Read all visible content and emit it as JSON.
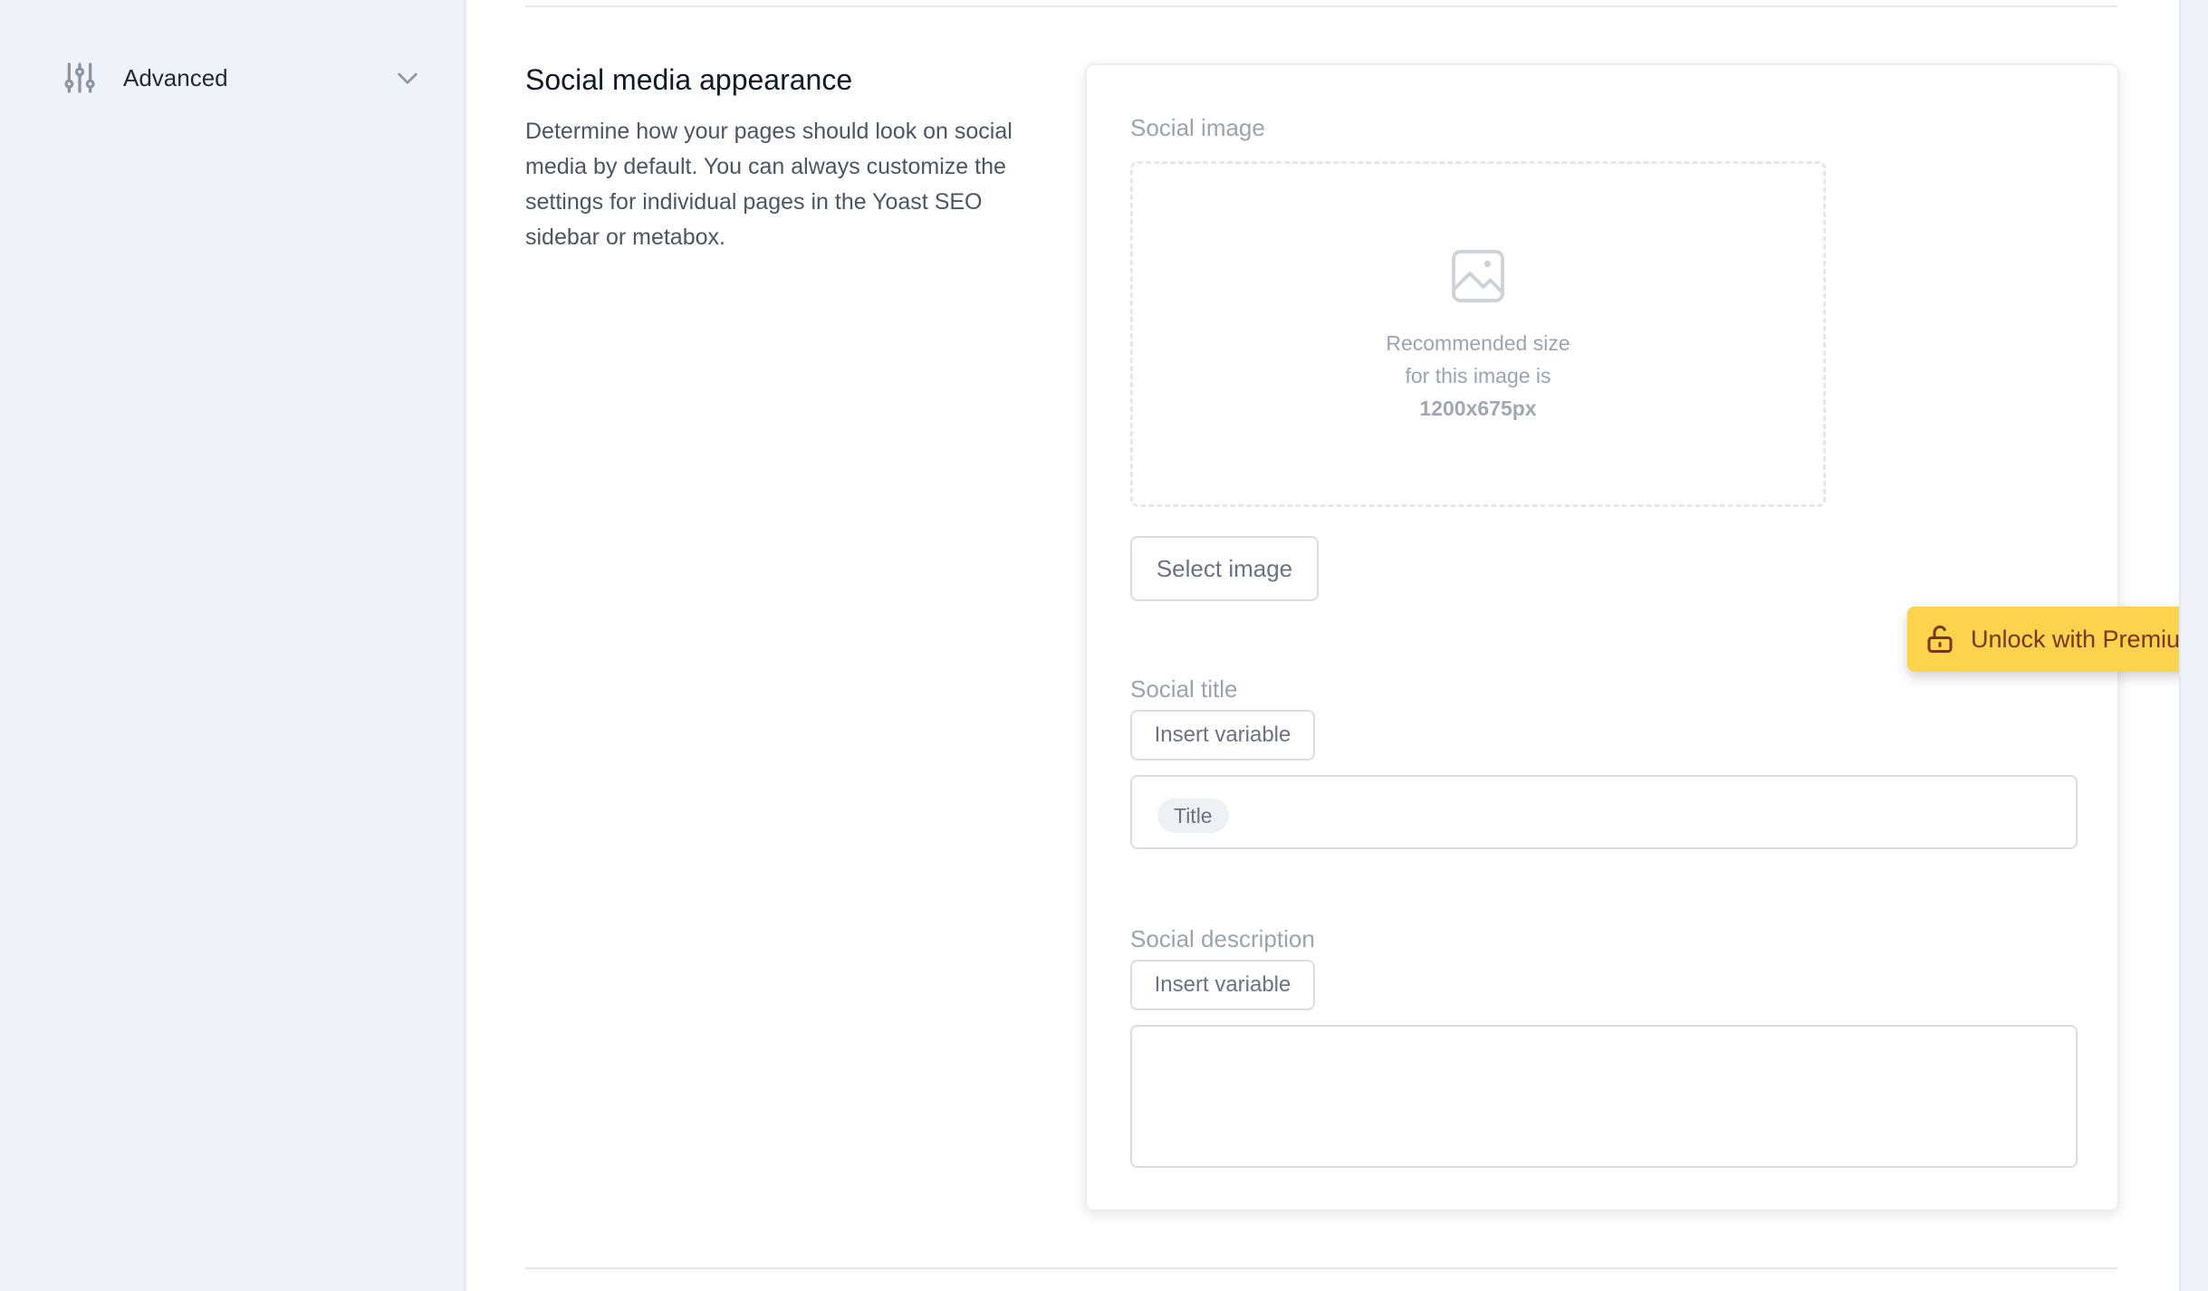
{
  "sidebar": {
    "item": {
      "label": "Advanced",
      "icon": "sliders-icon"
    }
  },
  "section": {
    "title": "Social media appearance",
    "description": "Determine how your pages should look on social media by default. You can always customize the settings for individual pages in the Yoast SEO sidebar or metabox."
  },
  "social_image": {
    "label": "Social image",
    "hint_line1": "Recommended size",
    "hint_line2": "for this image is",
    "hint_size": "1200x675px",
    "select_button": "Select image"
  },
  "premium": {
    "label": "Unlock with Premium",
    "color": "#fcd34d"
  },
  "social_title": {
    "label": "Social title",
    "insert_variable": "Insert variable",
    "pill": "Title"
  },
  "social_description": {
    "label": "Social description",
    "insert_variable": "Insert variable",
    "value": ""
  }
}
